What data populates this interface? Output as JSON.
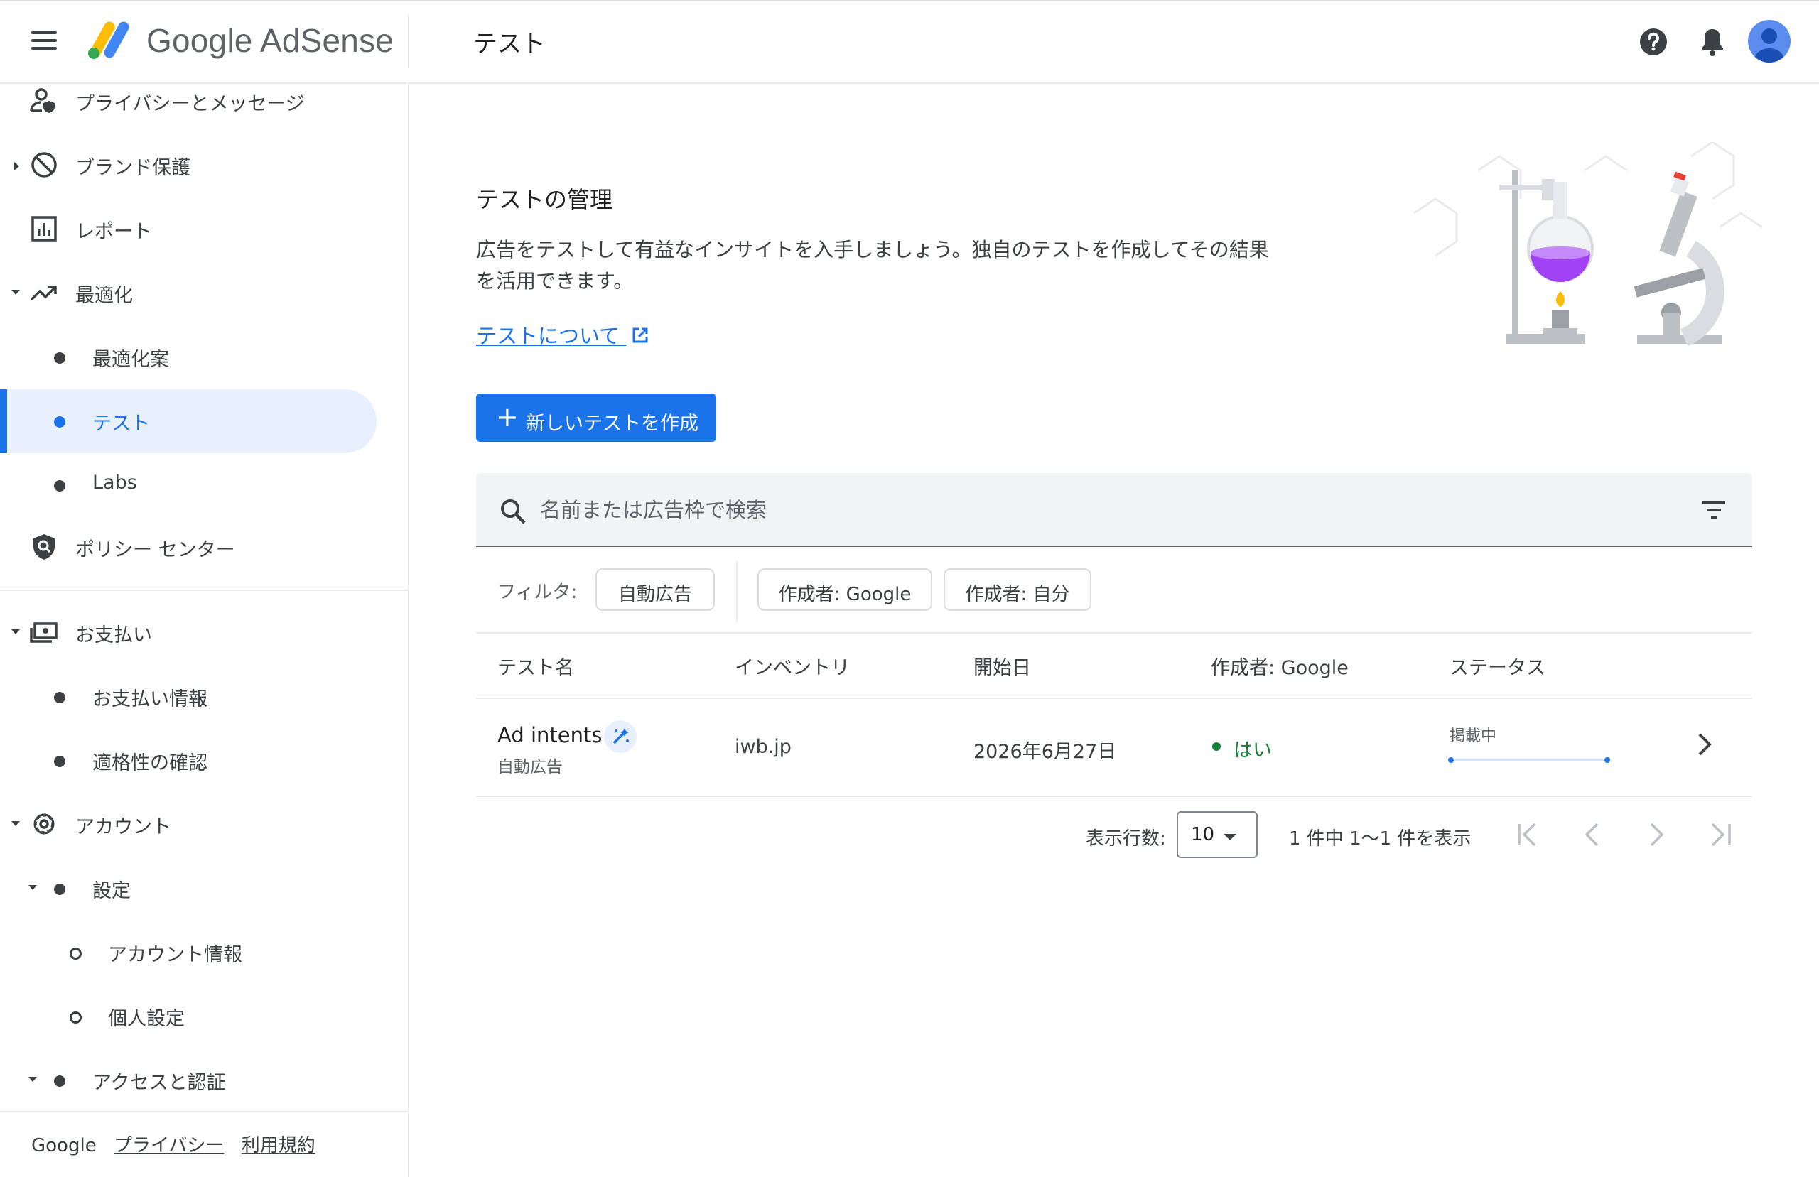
{
  "header": {
    "brand": "Google AdSense",
    "page_title": "テスト"
  },
  "sidebar": {
    "items": [
      {
        "label": "プライバシーとメッセージ",
        "icon": "privacy-person-icon"
      },
      {
        "label": "ブランド保護",
        "icon": "block-icon"
      },
      {
        "label": "レポート",
        "icon": "bar-chart-icon"
      },
      {
        "label": "最適化",
        "icon": "trending-up-icon"
      },
      {
        "label": "最適化案"
      },
      {
        "label": "テスト",
        "selected": true
      },
      {
        "label": "Labs"
      },
      {
        "label": "ポリシー センター",
        "icon": "policy-shield-icon"
      },
      {
        "label": "お支払い",
        "icon": "payments-icon"
      },
      {
        "label": "お支払い情報"
      },
      {
        "label": "適格性の確認"
      },
      {
        "label": "アカウント",
        "icon": "settings-gear-icon"
      },
      {
        "label": "設定"
      },
      {
        "label": "アカウント情報"
      },
      {
        "label": "個人設定"
      },
      {
        "label": "アクセスと認証"
      }
    ],
    "footer": {
      "google": "Google",
      "privacy": "プライバシー",
      "terms": "利用規約"
    }
  },
  "hero": {
    "title": "テストの管理",
    "description": "広告をテストして有益なインサイトを入手しましょう。独自のテストを作成してその結果を活用できます。",
    "link": "テストについて"
  },
  "create_button": {
    "label": "新しいテストを作成"
  },
  "search": {
    "placeholder": "名前または広告枠で検索"
  },
  "filters": {
    "label": "フィルタ:",
    "chips": [
      "自動広告",
      "作成者: Google",
      "作成者: 自分"
    ]
  },
  "table": {
    "headers": [
      "テスト名",
      "インベントリ",
      "開始日",
      "作成者: Google",
      "ステータス"
    ],
    "rows": [
      {
        "name": "Ad intents",
        "type": "自動広告",
        "inventory": "iwb.jp",
        "start_date": "2026年6月27日",
        "by_google": "はい",
        "status": "掲載中"
      }
    ]
  },
  "pagination": {
    "rows_label": "表示行数:",
    "rows_value": "10",
    "range": "1 件中 1〜1 件を表示"
  },
  "colors": {
    "accent": "#1a73e8",
    "selected_bg": "#e8f0fe",
    "success": "#188038"
  }
}
